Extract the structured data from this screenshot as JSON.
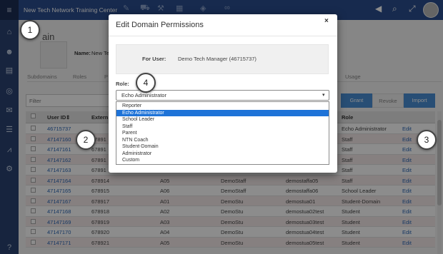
{
  "app": {
    "title": "New Tech Network Training Center",
    "menu_icon": "hamburger-icon",
    "tool_icons": [
      "pencil-icon",
      "truck-icon",
      "wrench-icon",
      "calendar-icon",
      "tag-icon",
      "binoculars-icon"
    ],
    "right_icons": [
      "megaphone-icon",
      "search-icon",
      "expand-icon"
    ]
  },
  "sidebar": {
    "icons": [
      "bank-icon",
      "users-icon",
      "book-icon",
      "target-icon",
      "envelope-icon",
      "list-icon",
      "chart-icon",
      "gears-icon",
      "help-icon"
    ],
    "help_glyph": "?"
  },
  "page": {
    "title": "ain",
    "name_label": "Name:",
    "name_value": "New Te",
    "tabs": [
      "Subdomains",
      "Roles",
      "P",
      "Usage"
    ],
    "filter_placeholder": "Filter",
    "buttons": {
      "grant": "Grant",
      "revoke": "Revoke",
      "import": "Import"
    }
  },
  "grid": {
    "columns": [
      "User ID",
      "Extern",
      "",
      "",
      "",
      "Role",
      ""
    ],
    "rows": [
      [
        "46715737",
        "",
        "",
        "",
        "",
        "Echo Administrator",
        "Edit"
      ],
      [
        "47147160",
        "67891",
        "",
        "",
        "",
        "Staff",
        "Edit"
      ],
      [
        "47147161",
        "67891",
        "",
        "",
        "",
        "Staff",
        "Edit"
      ],
      [
        "47147162",
        "67891",
        "",
        "",
        "",
        "Staff",
        "Edit"
      ],
      [
        "47147163",
        "67891",
        "",
        "",
        "",
        "Staff",
        "Edit"
      ],
      [
        "47147164",
        "678914",
        "A05",
        "DemoStaff",
        "demostaffa05",
        "Staff",
        "Edit"
      ],
      [
        "47147165",
        "678915",
        "A06",
        "DemoStaff",
        "demostaffa06",
        "School Leader",
        "Edit"
      ],
      [
        "47147167",
        "678917",
        "A01",
        "DemoStu",
        "demostua01",
        "Student-Domain",
        "Edit"
      ],
      [
        "47147168",
        "678918",
        "A02",
        "DemoStu",
        "demostua02test",
        "Student",
        "Edit"
      ],
      [
        "47147169",
        "678919",
        "A03",
        "DemoStu",
        "demostua03test",
        "Student",
        "Edit"
      ],
      [
        "47147170",
        "678920",
        "A04",
        "DemoStu",
        "demostua04test",
        "Student",
        "Edit"
      ],
      [
        "47147171",
        "678921",
        "A05",
        "DemoStu",
        "demostua05test",
        "Student",
        "Edit"
      ]
    ]
  },
  "modal": {
    "title": "Edit Domain Permissions",
    "close": "×",
    "for_user_label": "For User:",
    "for_user_value": "Demo Tech Manager (46715737)",
    "role_label": "Role:",
    "role_selected": "Echo Administrator",
    "role_options": [
      "Reporter",
      "Echo Administrator",
      "School Leader",
      "Staff",
      "Parent",
      "NTN Coach",
      "Student-Domain",
      "Administrator",
      "Custom"
    ],
    "highlighted_option": "Echo Administrator"
  },
  "callouts": [
    "1",
    "2",
    "3",
    "4"
  ],
  "colors": {
    "topbar": "#2a4d8f",
    "sidebar": "#2a4372",
    "accent": "#4a8fd6",
    "selection": "#1e73d8"
  }
}
